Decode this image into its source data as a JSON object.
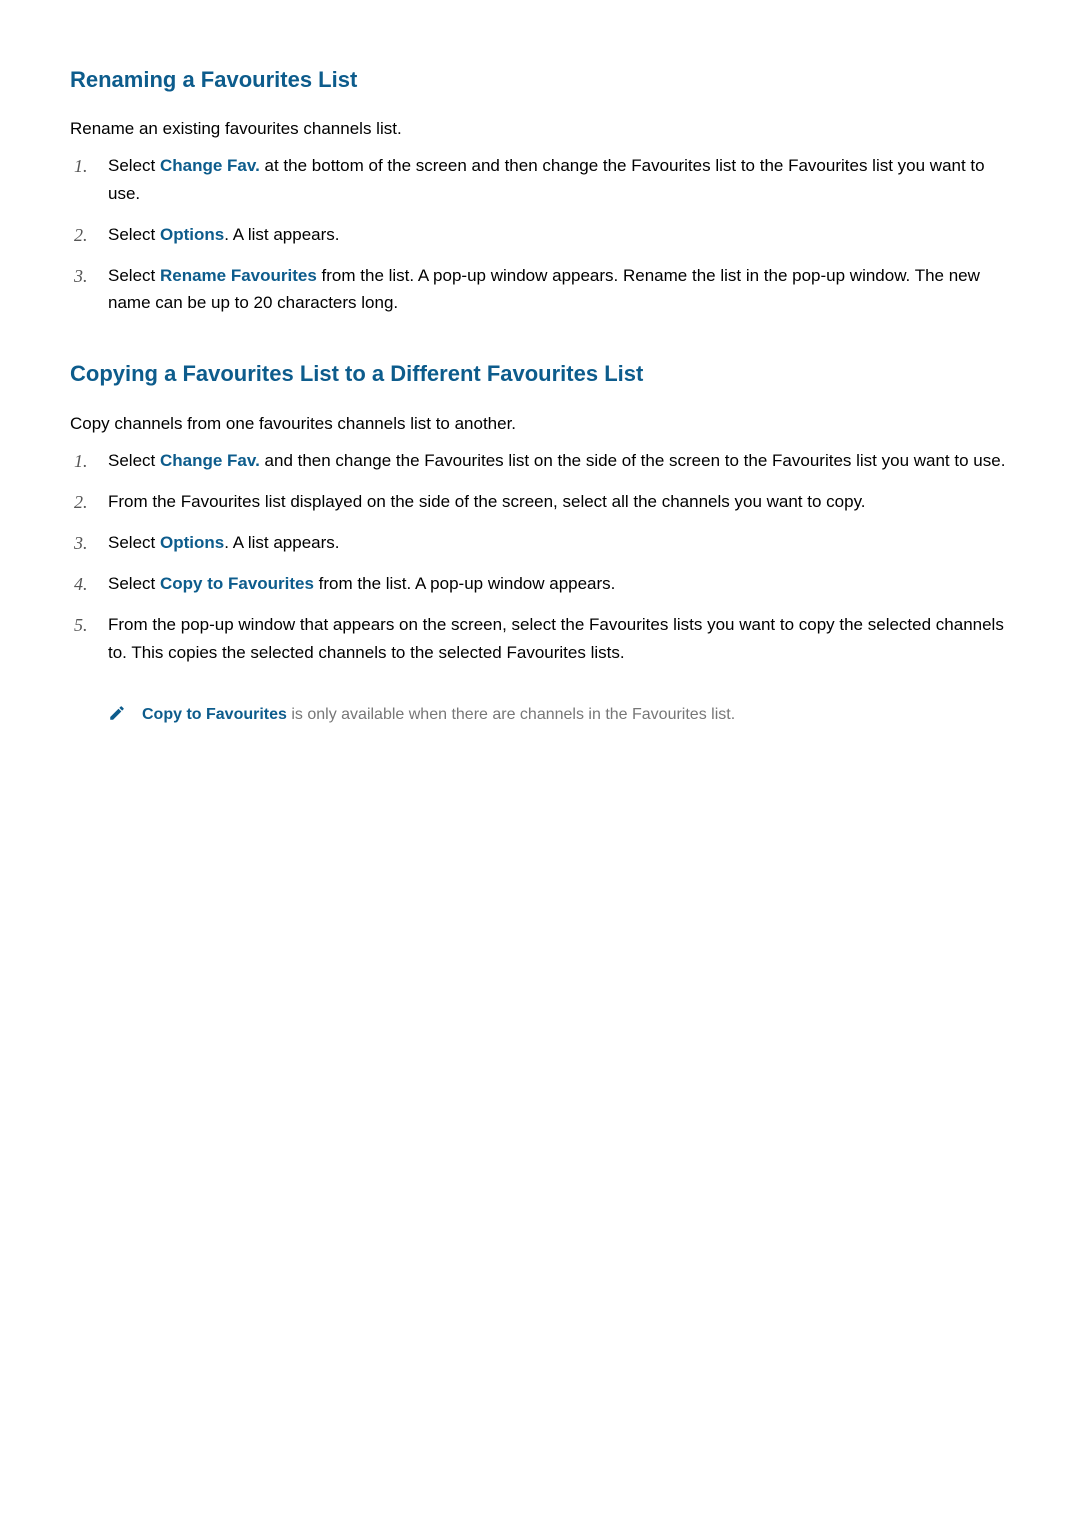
{
  "section1": {
    "heading": "Renaming a Favourites List",
    "intro": "Rename an existing favourites channels list.",
    "steps": [
      {
        "num": "1.",
        "pre": "Select ",
        "hl": "Change Fav.",
        "post": " at the bottom of the screen and then change the Favourites list to the Favourites list you want to use."
      },
      {
        "num": "2.",
        "pre": "Select ",
        "hl": "Options",
        "post": ". A list appears."
      },
      {
        "num": "3.",
        "pre": "Select ",
        "hl": "Rename Favourites",
        "post": " from the list. A pop-up window appears. Rename the list in the pop-up window. The new name can be up to 20 characters long."
      }
    ]
  },
  "section2": {
    "heading": "Copying a Favourites List to a Different Favourites List",
    "intro": "Copy channels from one favourites channels list to another.",
    "steps": [
      {
        "num": "1.",
        "pre": "Select ",
        "hl": "Change Fav.",
        "post": " and then change the Favourites list on the side of the screen to the Favourites list you want to use."
      },
      {
        "num": "2.",
        "pre": "",
        "hl": "",
        "post": "From the Favourites list displayed on the side of the screen, select all the channels you want to copy."
      },
      {
        "num": "3.",
        "pre": "Select ",
        "hl": "Options",
        "post": ". A list appears."
      },
      {
        "num": "4.",
        "pre": "Select ",
        "hl": "Copy to Favourites",
        "post": " from the list. A pop-up window appears."
      },
      {
        "num": "5.",
        "pre": "",
        "hl": "",
        "post": "From the pop-up window that appears on the screen, select the Favourites lists you want to copy the selected channels to. This copies the selected channels to the selected Favourites lists."
      }
    ],
    "note": {
      "hl": "Copy to Favourites",
      "post": " is only available when there are channels in the Favourites list."
    }
  }
}
